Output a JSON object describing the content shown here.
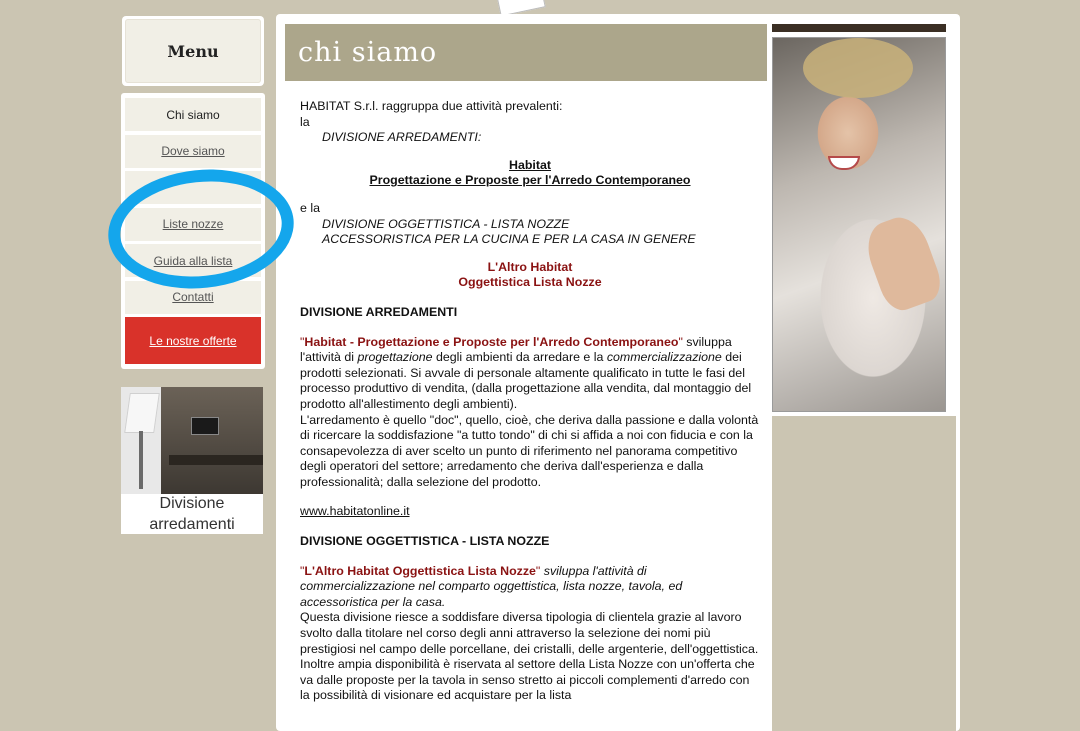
{
  "menu": {
    "title": "Menu",
    "items": [
      {
        "label": "Chi siamo"
      },
      {
        "label": "Dove siamo"
      },
      {
        "label": ""
      },
      {
        "label": "Liste nozze"
      },
      {
        "label": "Guida alla lista"
      },
      {
        "label": "Contatti"
      }
    ],
    "offers_label": "Le nostre offerte"
  },
  "promo": {
    "line1": "Divisione",
    "line2": "arredamenti"
  },
  "page": {
    "title": "chi siamo",
    "intro1": "HABITAT S.r.l. raggruppa due attività prevalenti:",
    "intro2": "la",
    "div_arr_italic": "DIVISIONE ARREDAMENTI:",
    "habitat_name": "Habitat",
    "habitat_sub": "Progettazione e Proposte per l'Arredo Contemporaneo",
    "e_la": "e la",
    "div_ogg_line1": "DIVISIONE OGGETTISTICA - LISTA NOZZE",
    "div_ogg_line2": "ACCESSORISTICA PER LA CUCINA E PER LA CASA IN GENERE",
    "altro_name": "L'Altro Habitat",
    "altro_sub": "Oggettistica Lista Nozze",
    "h_arredamenti": "DIVISIONE ARREDAMENTI",
    "p1_quote_open": "\"",
    "p1_brand": "Habitat - Progettazione e Proposte per l'Arredo Contemporaneo",
    "p1_quote_close": "\"",
    "p1_a": " sviluppa l'attività di ",
    "p1_i1": "progettazione",
    "p1_b": " degli ambienti da arredare e la ",
    "p1_i2": "commercializzazione",
    "p1_c": " dei prodotti selezionati. Si avvale di personale altamente qualificato in tutte le fasi del processo produttivo di vendita, (dalla progettazione alla vendita, dal montaggio del prodotto all'allestimento degli ambienti).",
    "p2": "L'arredamento è quello \"doc\", quello, cioè, che deriva dalla passione e dalla volontà di ricercare la soddisfazione \"a tutto tondo\" di chi si affida a noi con fiducia e con la consapevolezza di aver scelto un punto di riferimento nel panorama competitivo degli operatori del settore; arredamento che deriva dall'esperienza e dalla professionalità; dalla selezione del prodotto.",
    "website": "www.habitatonline.it",
    "h_oggettistica": "DIVISIONE OGGETTISTICA - LISTA NOZZE",
    "p3_brand": "L'Altro Habitat Oggettistica Lista Nozze",
    "p3_italic": " sviluppa l'attività di commercializzazione nel comparto oggettistica, lista nozze, tavola, ed accessoristica per la casa.",
    "p4": "Questa divisione riesce a soddisfare diversa tipologia di clientela grazie al lavoro svolto dalla titolare nel corso degli anni attraverso la selezione dei nomi più prestigiosi nel campo delle porcellane, dei cristalli, delle argenterie, dell'oggettistica.",
    "p5": "Inoltre ampia disponibilità è riservata al settore della Lista Nozze con un'offerta che va dalle proposte per la tavola in senso stretto ai piccoli complementi d'arredo con la possibilità di visionare ed acquistare per la lista"
  },
  "colors": {
    "background": "#cbc5b2",
    "header": "#aca68b",
    "accent_red": "#8a1212",
    "offers_button": "#d9322a",
    "annotation": "#14a6ec"
  }
}
